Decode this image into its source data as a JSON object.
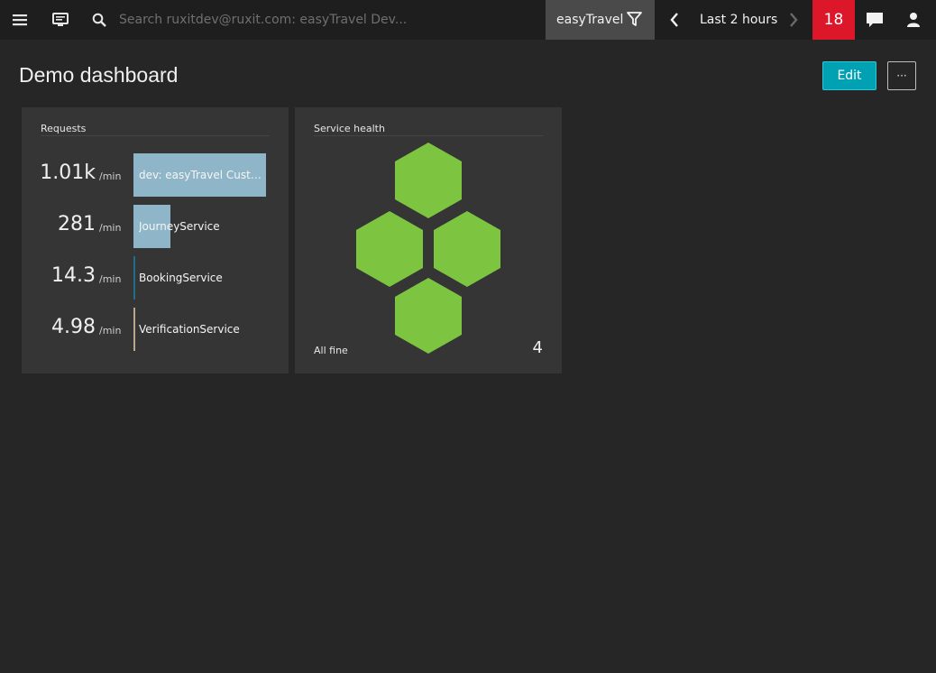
{
  "topbar": {
    "menu_icon": "hamburger-icon",
    "dashboard_icon": "monitor-icon",
    "search_icon": "search-icon",
    "search_placeholder": "Search ruxitdev@ruxit.com: easyTravel Dev...",
    "environment": "easyTravel",
    "filter_icon": "filter-icon",
    "timeframe": "Last 2 hours",
    "prev_icon": "chevron-left-icon",
    "next_icon": "chevron-right-icon",
    "problem_count": "18",
    "problem_color": "#dc172a",
    "chat_icon": "chat-icon",
    "user_icon": "user-icon"
  },
  "header": {
    "title": "Demo dashboard",
    "edit_label": "Edit",
    "more_label": "···",
    "accent_color": "#00a1b2"
  },
  "tiles": {
    "requests": {
      "title": "Requests",
      "unit": "/min",
      "rows": [
        {
          "value": "1.01k",
          "name": "dev: easyTravel Custom...",
          "share": 1.0,
          "color": "#8fb6c8"
        },
        {
          "value": "281",
          "name": "JourneyService",
          "share": 0.28,
          "color": "#8fb6c8"
        },
        {
          "value": "14.3",
          "name": "BookingService",
          "share": 0.014,
          "color": "#1f6f8b"
        },
        {
          "value": "4.98",
          "name": "VerificationService",
          "share": 0.005,
          "color": "#b9a88a"
        }
      ]
    },
    "service_health": {
      "title": "Service health",
      "status": "All fine",
      "count": "4",
      "healthy_color": "#7dc540"
    }
  }
}
